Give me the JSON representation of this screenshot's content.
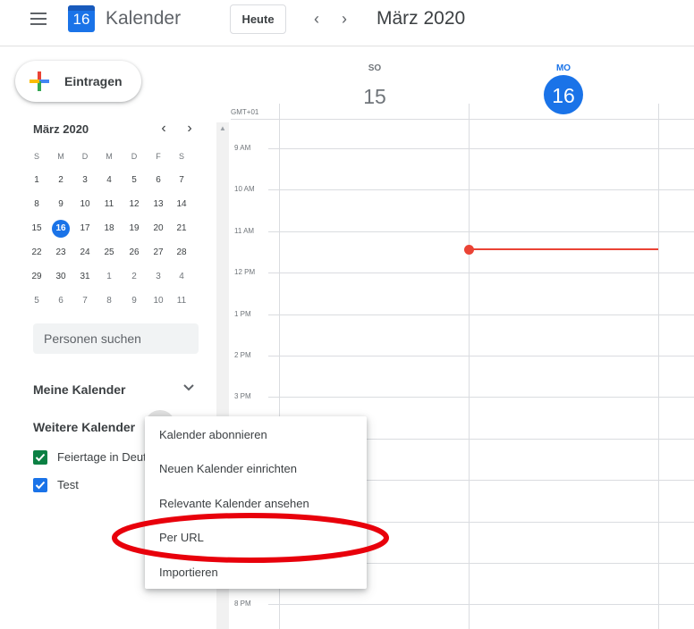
{
  "header": {
    "app_title": "Kalender",
    "logo_day": "16",
    "today_label": "Heute",
    "prev_label": "‹",
    "next_label": "›",
    "month_title": "März 2020"
  },
  "create_button": {
    "label": "Eintragen"
  },
  "mini_calendar": {
    "title": "März 2020",
    "prev": "‹",
    "next": "›",
    "weekdays": [
      "S",
      "M",
      "D",
      "M",
      "D",
      "F",
      "S"
    ],
    "weeks": [
      [
        "1",
        "2",
        "3",
        "4",
        "5",
        "6",
        "7"
      ],
      [
        "8",
        "9",
        "10",
        "11",
        "12",
        "13",
        "14"
      ],
      [
        "15",
        "16",
        "17",
        "18",
        "19",
        "20",
        "21"
      ],
      [
        "22",
        "23",
        "24",
        "25",
        "26",
        "27",
        "28"
      ],
      [
        "29",
        "30",
        "31",
        "1",
        "2",
        "3",
        "4"
      ],
      [
        "5",
        "6",
        "7",
        "8",
        "9",
        "10",
        "11"
      ]
    ],
    "today": "16"
  },
  "search_people": {
    "placeholder": "Personen suchen"
  },
  "my_calendars": {
    "title": "Meine Kalender"
  },
  "other_calendars": {
    "title": "Weitere Kalender",
    "items": [
      {
        "label": "Feiertage in Deutschland",
        "color": "#0b8043"
      },
      {
        "label": "Test",
        "color": "#1a73e8"
      }
    ]
  },
  "day_view": {
    "timezone": "GMT+01",
    "days": [
      {
        "dow": "SO",
        "num": "15",
        "current": false
      },
      {
        "dow": "MO",
        "num": "16",
        "current": true
      }
    ],
    "hours": [
      "9 AM",
      "10 AM",
      "11 AM",
      "12 PM",
      "1 PM",
      "2 PM",
      "3 PM",
      "",
      "",
      "",
      "",
      "8 PM"
    ]
  },
  "context_menu": {
    "items": [
      "Kalender abonnieren",
      "Neuen Kalender einrichten",
      "Relevante Kalender ansehen",
      "Per URL",
      "Importieren"
    ],
    "highlighted": "Per URL"
  },
  "colors": {
    "accent": "#1a73e8",
    "now_line": "#ea4335",
    "annotation": "#e8000b"
  }
}
